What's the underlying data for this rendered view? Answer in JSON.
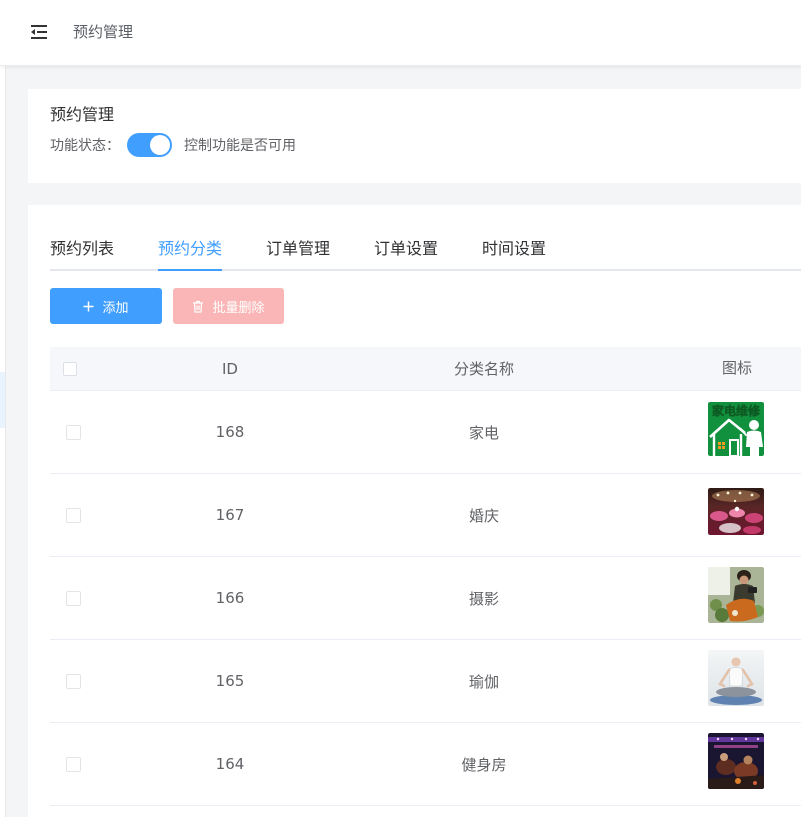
{
  "header": {
    "menu_icon": "menu-fold-icon",
    "title": "预约管理"
  },
  "feature_card": {
    "title": "预约管理",
    "status_label": "功能状态：",
    "status_enabled": true,
    "status_hint": "控制功能是否可用"
  },
  "tabs": [
    {
      "label": "预约列表",
      "active": false
    },
    {
      "label": "预约分类",
      "active": true
    },
    {
      "label": "订单管理",
      "active": false
    },
    {
      "label": "订单设置",
      "active": false
    },
    {
      "label": "时间设置",
      "active": false
    }
  ],
  "toolbar": {
    "add": {
      "label": "添加",
      "icon": "plus-icon"
    },
    "batch_delete": {
      "label": "批量删除",
      "icon": "trash-icon",
      "disabled": true
    }
  },
  "table": {
    "columns": {
      "id": "ID",
      "name": "分类名称",
      "icon": "图标"
    },
    "rows": [
      {
        "id": "168",
        "name": "家电",
        "icon": "appliance-repair-image",
        "icon_text": "家电维修"
      },
      {
        "id": "167",
        "name": "婚庆",
        "icon": "wedding-image"
      },
      {
        "id": "166",
        "name": "摄影",
        "icon": "photography-image"
      },
      {
        "id": "165",
        "name": "瑜伽",
        "icon": "yoga-image"
      },
      {
        "id": "164",
        "name": "健身房",
        "icon": "gym-image"
      }
    ]
  },
  "colors": {
    "primary": "#409eff",
    "danger_disabled": "#fab6b6",
    "text_primary": "#303133",
    "text_regular": "#606266"
  }
}
